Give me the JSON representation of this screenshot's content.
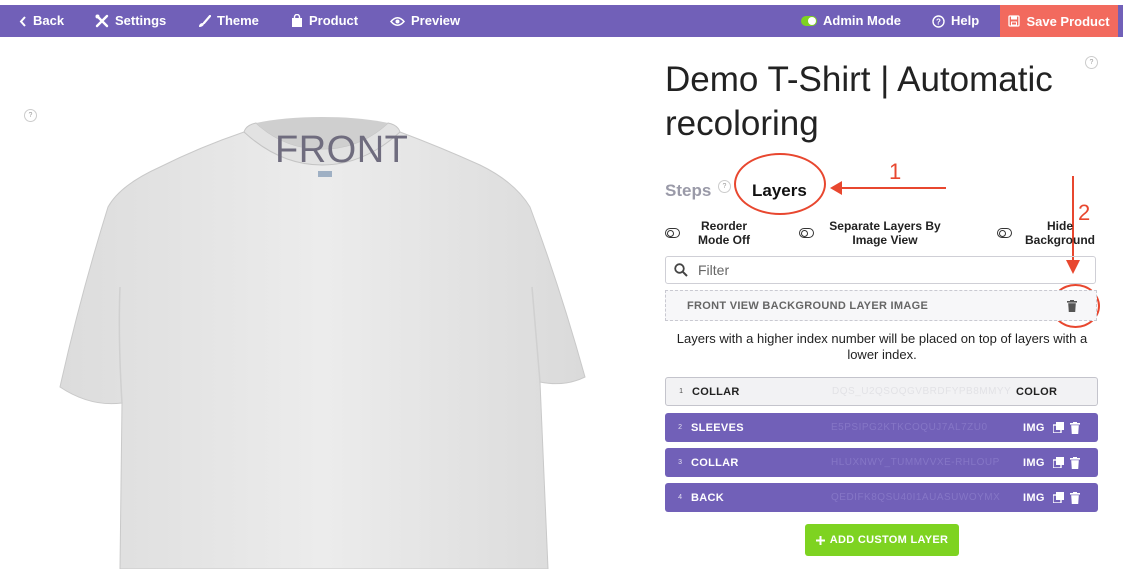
{
  "toolbar": {
    "back": "Back",
    "settings": "Settings",
    "theme": "Theme",
    "product": "Product",
    "preview": "Preview",
    "admin_mode": "Admin Mode",
    "help": "Help",
    "save": "Save Product"
  },
  "colors": {
    "toolbar": "#7160b8",
    "save": "#f26a5e",
    "accent_green": "#7ed321",
    "annotation": "#e8472f"
  },
  "canvas": {
    "view_label": "FRONT",
    "help_mark": "?"
  },
  "product": {
    "title": "Demo T-Shirt | Automatic recoloring",
    "help_mark": "?"
  },
  "tabs": {
    "steps": "Steps",
    "layers": "Layers",
    "help_mark": "?"
  },
  "annotations": {
    "one": "1",
    "two": "2"
  },
  "options": {
    "reorder": "Reorder Mode Off",
    "separate": "Separate Layers By Image View",
    "hide_bg": "Hide Background"
  },
  "filter": {
    "placeholder": "Filter"
  },
  "background_layer": {
    "label": "FRONT VIEW BACKGROUND LAYER IMAGE"
  },
  "info_text": "Layers with a higher index number will be placed on top of layers with a lower index.",
  "layers": [
    {
      "index": "1",
      "name": "COLLAR",
      "id": "DQS_U2QSOQGVBRDFYPB8MMYY",
      "type": "COLOR"
    },
    {
      "index": "2",
      "name": "SLEEVES",
      "id": "E5PSIPG2KTKCOQUJ7AL7ZU0",
      "type": "IMG"
    },
    {
      "index": "3",
      "name": "COLLAR",
      "id": "HLUXNWY_TUMMVVXE-RHLOUP",
      "type": "IMG"
    },
    {
      "index": "4",
      "name": "BACK",
      "id": "QEDIFK8QSU40I1AUASUWOYMX",
      "type": "IMG"
    }
  ],
  "add_button": "ADD CUSTOM LAYER",
  "icons": [
    "chevron-left-icon",
    "tools-icon",
    "brush-icon",
    "bag-icon",
    "eye-icon",
    "toggle-icon",
    "question-circle-icon",
    "save-icon",
    "search-icon",
    "trash-icon",
    "copy-icon",
    "plus-icon"
  ]
}
